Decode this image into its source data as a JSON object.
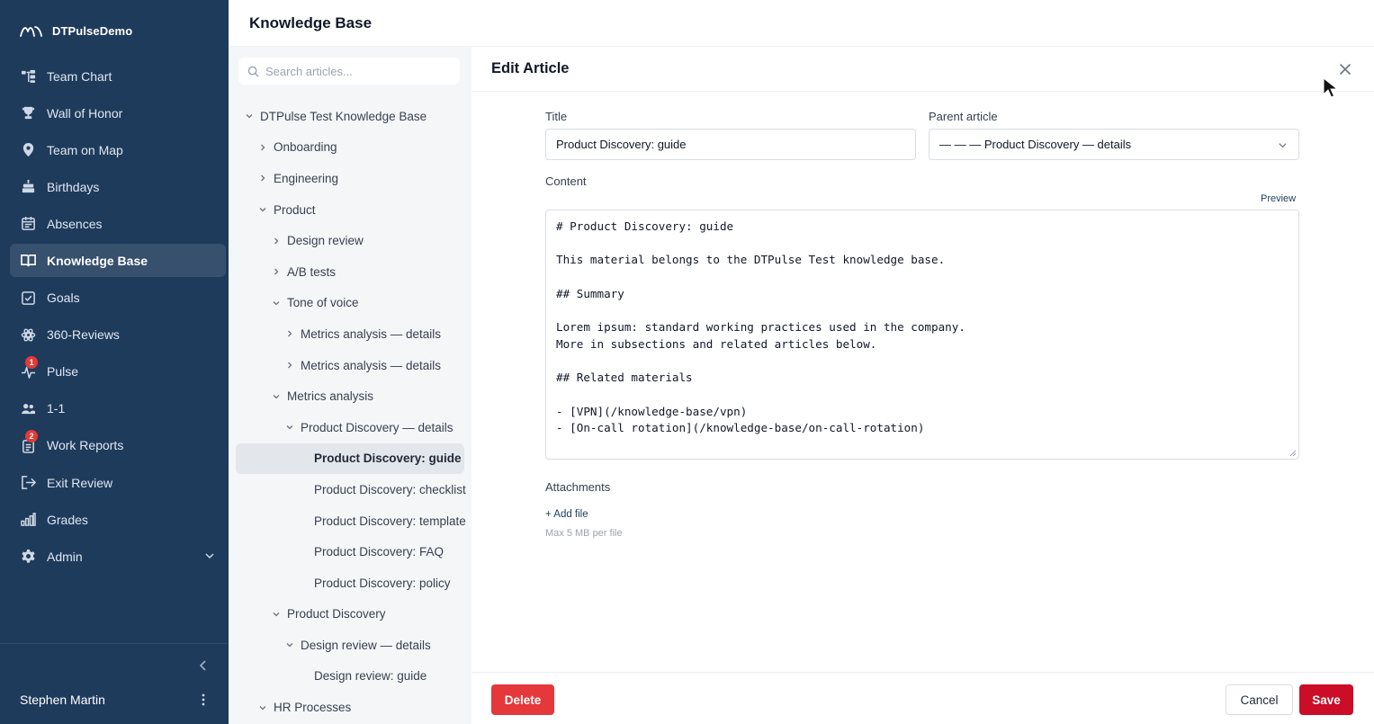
{
  "app": {
    "name": "DTPulseDemo"
  },
  "sidebar": {
    "items": [
      {
        "label": "Team Chart",
        "icon": "team-chart-icon"
      },
      {
        "label": "Wall of Honor",
        "icon": "trophy-icon"
      },
      {
        "label": "Team on Map",
        "icon": "map-pin-icon"
      },
      {
        "label": "Birthdays",
        "icon": "cake-icon"
      },
      {
        "label": "Absences",
        "icon": "calendar-icon"
      },
      {
        "label": "Knowledge Base",
        "icon": "book-icon",
        "active": true
      },
      {
        "label": "Goals",
        "icon": "checkbox-icon"
      },
      {
        "label": "360-Reviews",
        "icon": "reviews-icon"
      },
      {
        "label": "Pulse",
        "icon": "pulse-icon",
        "badge": "1"
      },
      {
        "label": "1-1",
        "icon": "people-icon"
      },
      {
        "label": "Work Reports",
        "icon": "report-icon",
        "badge": "2"
      },
      {
        "label": "Exit Review",
        "icon": "exit-icon"
      },
      {
        "label": "Grades",
        "icon": "bar-chart-icon"
      },
      {
        "label": "Admin",
        "icon": "gear-icon"
      }
    ],
    "user": "Stephen Martin"
  },
  "header": {
    "title": "Knowledge Base"
  },
  "tree": {
    "search_placeholder": "Search articles...",
    "items": [
      {
        "label": "DTPulse Test Knowledge Base",
        "level": 0,
        "state": "open"
      },
      {
        "label": "Onboarding",
        "level": 1,
        "state": "closed"
      },
      {
        "label": "Engineering",
        "level": 1,
        "state": "closed"
      },
      {
        "label": "Product",
        "level": 1,
        "state": "open"
      },
      {
        "label": "Design review",
        "level": 2,
        "state": "closed"
      },
      {
        "label": "A/B tests",
        "level": 2,
        "state": "closed"
      },
      {
        "label": "Tone of voice",
        "level": 2,
        "state": "open"
      },
      {
        "label": "Metrics analysis — details",
        "level": 3,
        "state": "closed"
      },
      {
        "label": "Metrics analysis — details",
        "level": 3,
        "state": "closed"
      },
      {
        "label": "Metrics analysis",
        "level": 2,
        "state": "open"
      },
      {
        "label": "Product Discovery — details",
        "level": 3,
        "state": "open"
      },
      {
        "label": "Product Discovery: guide",
        "level": 4,
        "state": "leaf",
        "selected": true
      },
      {
        "label": "Product Discovery: checklist",
        "level": 4,
        "state": "leaf"
      },
      {
        "label": "Product Discovery: template",
        "level": 4,
        "state": "leaf"
      },
      {
        "label": "Product Discovery: FAQ",
        "level": 4,
        "state": "leaf"
      },
      {
        "label": "Product Discovery: policy",
        "level": 4,
        "state": "leaf"
      },
      {
        "label": "Product Discovery",
        "level": 2,
        "state": "open"
      },
      {
        "label": "Design review — details",
        "level": 3,
        "state": "open"
      },
      {
        "label": "Design review: guide",
        "level": 4,
        "state": "leaf"
      },
      {
        "label": "HR Processes",
        "level": 1,
        "state": "open"
      }
    ]
  },
  "editor": {
    "heading": "Edit Article",
    "title_label": "Title",
    "title_value": "Product Discovery: guide",
    "parent_label": "Parent article",
    "parent_value": "— — — Product Discovery — details",
    "content_label": "Content",
    "preview_label": "Preview",
    "content_value": "# Product Discovery: guide\n\nThis material belongs to the DTPulse Test knowledge base.\n\n## Summary\n\nLorem ipsum: standard working practices used in the company.\nMore in subsections and related articles below.\n\n## Related materials\n\n- [VPN](/knowledge-base/vpn)\n- [On-call rotation](/knowledge-base/on-call-rotation)",
    "attachments_label": "Attachments",
    "add_file_label": "+ Add file",
    "attachments_hint": "Max 5 MB per file",
    "delete_label": "Delete",
    "cancel_label": "Cancel",
    "save_label": "Save"
  },
  "colors": {
    "sidebar_bg": "#1f3b5c",
    "sidebar_active": "#36506e",
    "delete": "#e5383b",
    "save": "#cc0d27",
    "badge": "#e53935"
  }
}
